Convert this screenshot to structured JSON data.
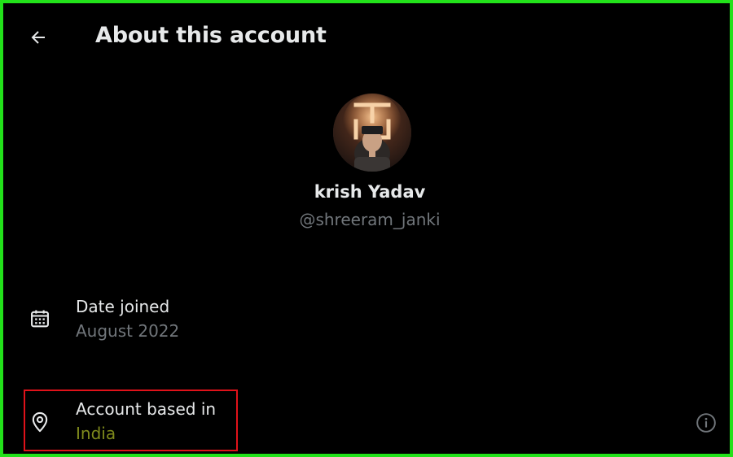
{
  "header": {
    "title": "About this account",
    "back_icon": "arrow-left-icon"
  },
  "profile": {
    "display_name": "krish Yadav",
    "handle": "@shreeram_janki",
    "avatar_icon": "avatar"
  },
  "details": {
    "date_joined": {
      "icon": "calendar-icon",
      "label": "Date joined",
      "value": "August 2022"
    },
    "account_based_in": {
      "icon": "location-pin-icon",
      "label": "Account based in",
      "value": "India",
      "value_color": "#7f8a1c"
    },
    "info_icon": "info-circle-icon"
  },
  "colors": {
    "background": "#000000",
    "frame_border": "#22e21a",
    "highlight_border": "#e0121a",
    "primary_text": "#e7e9ea",
    "secondary_text": "#71767b"
  }
}
